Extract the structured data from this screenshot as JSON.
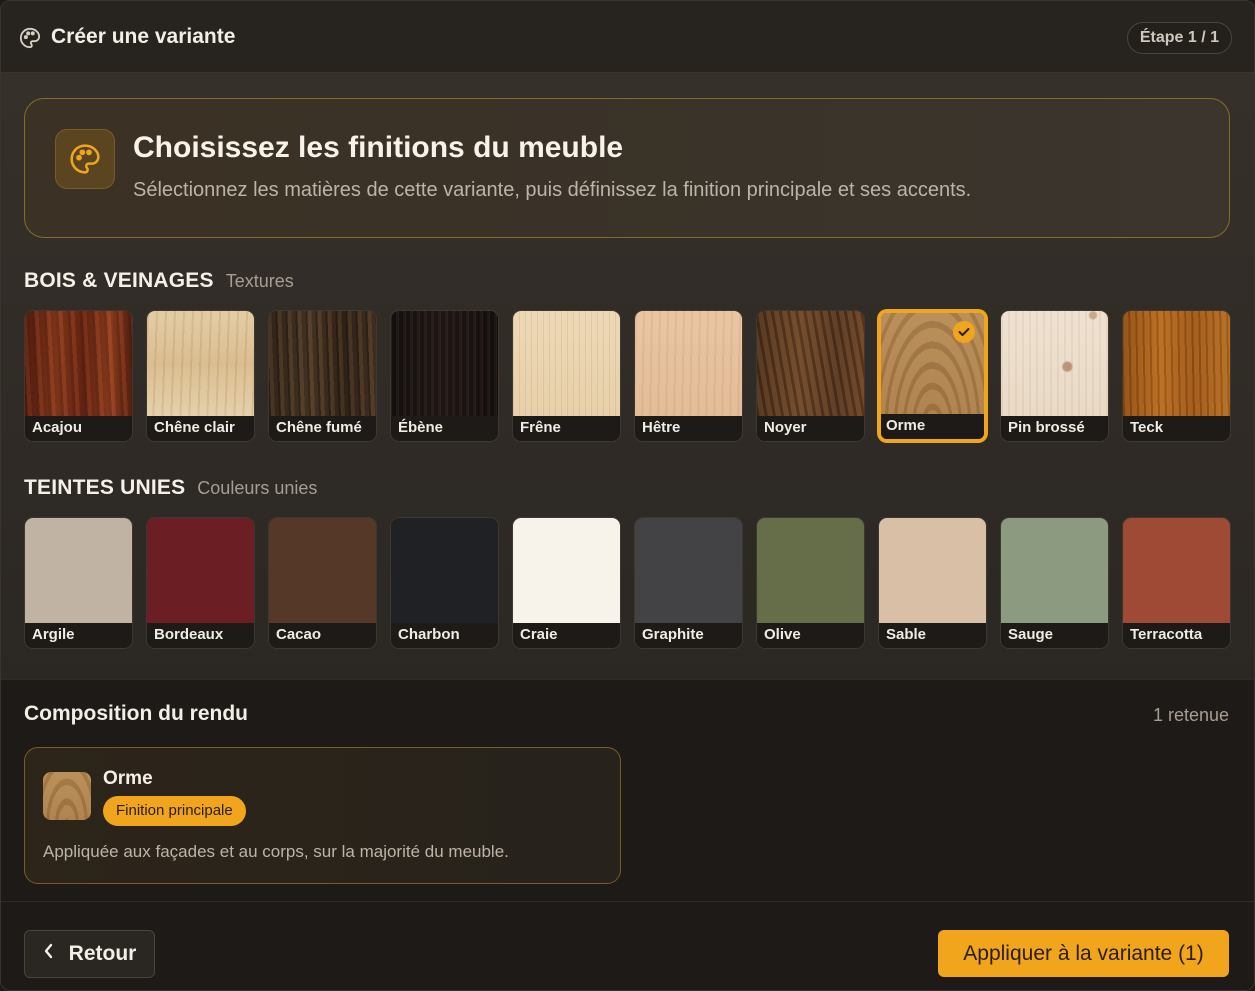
{
  "header": {
    "title": "Créer une variante",
    "step": "Étape 1 / 1",
    "title_icon": "palette-icon"
  },
  "hero": {
    "icon": "palette-icon",
    "title": "Choisissez les finitions du meuble",
    "subtitle": "Sélectionnez les matières de cette variante, puis définissez la finition principale et ses accents."
  },
  "woods": {
    "title": "BOIS & VEINAGES",
    "subtitle": "Textures",
    "items": [
      {
        "label": "Acajou",
        "texture": "tex-acajou",
        "selected": false
      },
      {
        "label": "Chêne clair",
        "texture": "tex-chene-clair",
        "selected": false
      },
      {
        "label": "Chêne fumé",
        "texture": "tex-chene-fume",
        "selected": false
      },
      {
        "label": "Ébène",
        "texture": "tex-ebene",
        "selected": false
      },
      {
        "label": "Frêne",
        "texture": "tex-frene",
        "selected": false
      },
      {
        "label": "Hêtre",
        "texture": "tex-hetre",
        "selected": false
      },
      {
        "label": "Noyer",
        "texture": "tex-noyer",
        "selected": false
      },
      {
        "label": "Orme",
        "texture": "tex-orme",
        "selected": true
      },
      {
        "label": "Pin brossé",
        "texture": "tex-pin",
        "selected": false
      },
      {
        "label": "Teck",
        "texture": "tex-teck",
        "selected": false
      }
    ]
  },
  "solids": {
    "title": "TEINTES UNIES",
    "subtitle": "Couleurs unies",
    "items": [
      {
        "label": "Argile",
        "color": "#c0b3a4"
      },
      {
        "label": "Bordeaux",
        "color": "#6b1e23"
      },
      {
        "label": "Cacao",
        "color": "#553828"
      },
      {
        "label": "Charbon",
        "color": "#202124"
      },
      {
        "label": "Craie",
        "color": "#f7f3ea"
      },
      {
        "label": "Graphite",
        "color": "#434346"
      },
      {
        "label": "Olive",
        "color": "#656e48"
      },
      {
        "label": "Sable",
        "color": "#d8bfa6"
      },
      {
        "label": "Sauge",
        "color": "#8c9a80"
      },
      {
        "label": "Terracotta",
        "color": "#9e4a34"
      }
    ]
  },
  "composition": {
    "title": "Composition du rendu",
    "count": "1 retenue",
    "card": {
      "name": "Orme",
      "badge": "Finition principale",
      "description": "Appliquée aux façades et au corps, sur la majorité du meuble."
    }
  },
  "footer": {
    "back_label": "Retour",
    "apply_label": "Appliquer à la variante (1)"
  },
  "colors": {
    "accent": "#f0a51c",
    "background": "#1c1917"
  }
}
